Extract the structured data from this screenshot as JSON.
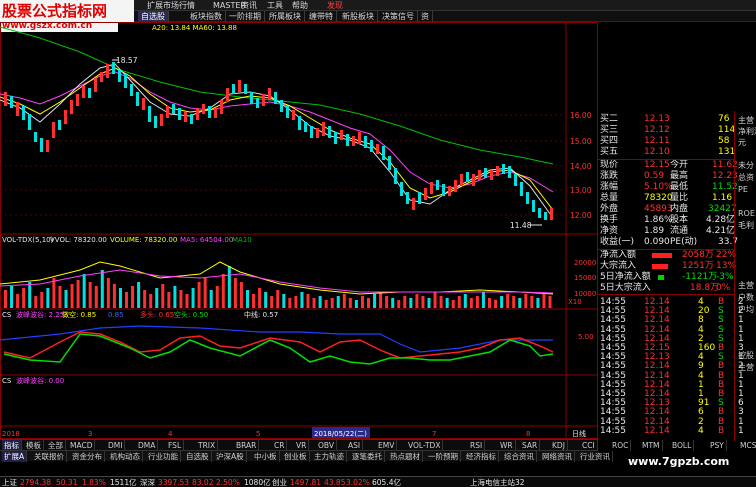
{
  "watermark": {
    "title": "股票公式指标网",
    "url": "www.gszx.com.cn",
    "bottom": "www.7gpzb.com"
  },
  "menu": {
    "items": [
      "扩展市场行情",
      "MASTER",
      "资讯",
      "工具",
      "帮助",
      "发现"
    ]
  },
  "tabs": [
    "自选股",
    "板块指数",
    "一阶排期",
    "所属板块",
    "缠带特",
    "新股板块",
    "决策信号",
    "资"
  ],
  "main_chart": {
    "ma_legend": "A20: 13.84  MA60: 13.88",
    "high_label": "18.57",
    "low_label": "11.48",
    "y_ticks": [
      "16.00",
      "15.00",
      "14.00",
      "13.00",
      "12.00"
    ]
  },
  "volume": {
    "legend_name": "VOL-TDX(5,10)",
    "legend_vvol": "VVOL: 78320.00",
    "legend_volume": "VOLUME: 78320.00",
    "legend_ma5": "MA5: 64504.00",
    "legend_ma10": "MA10",
    "y_ticks": [
      "20000",
      "15000",
      "10000"
    ],
    "unit": "X10"
  },
  "indicator1": {
    "name": "CS",
    "v1": "波峰波谷: 2.25",
    "v2": "做空: 0.85",
    "v3": "0.85",
    "v4": "多头: 0.65",
    "v5": "空头: 0.50",
    "mid": "中线: 0.57",
    "y_tick": "5.00"
  },
  "indicator2": {
    "name": "CS",
    "v1": "波峰波谷: 0.00"
  },
  "time_axis": {
    "year": "2018",
    "date_marker": "2018/05/22(二)",
    "marks": [
      "3",
      "4",
      "5",
      "6",
      "7",
      "8"
    ],
    "right": "日线"
  },
  "quote": {
    "asks": [
      {
        "label": "买二",
        "price": "12.13",
        "vol": "76"
      },
      {
        "label": "买三",
        "price": "12.12",
        "vol": "114"
      },
      {
        "label": "买四",
        "price": "12.11",
        "vol": "58"
      },
      {
        "label": "买五",
        "price": "12.10",
        "vol": "131"
      }
    ],
    "stats": [
      {
        "l1": "现价",
        "v1": "12.15",
        "l2": "今开",
        "v2": "11.62"
      },
      {
        "l1": "涨跌",
        "v1": "0.59",
        "l2": "最高",
        "v2": "12.23"
      },
      {
        "l1": "涨幅",
        "v1": "5.10%",
        "l2": "最低",
        "v2": "11.52"
      },
      {
        "l1": "总量",
        "v1": "78320",
        "l2": "量比",
        "v2": "1.16"
      },
      {
        "l1": "外盘",
        "v1": "45893",
        "l2": "内盘",
        "v2": "32427"
      },
      {
        "l1": "换手",
        "v1": "1.86%",
        "l2": "股本",
        "v2": "4.28亿"
      },
      {
        "l1": "净资",
        "v1": "1.89",
        "l2": "流通",
        "v2": "4.21亿"
      },
      {
        "l1": "收益(一)",
        "v1": "0.090",
        "l2": "PE(动)",
        "v2": "33.7"
      }
    ],
    "flows": [
      {
        "label": "净流入额",
        "value": "2058万",
        "pct": "22%",
        "bar": 0.6
      },
      {
        "label": "大宗流入",
        "value": "1251万",
        "pct": "13%",
        "bar": 0.45
      },
      {
        "label": "5日净流入额",
        "value": "-1121万",
        "pct": "-3%",
        "bar": 0.15
      },
      {
        "label": "5日大宗流入",
        "value": "18.8万",
        "pct": "0%",
        "bar": 0.05
      }
    ],
    "ticks": [
      {
        "t": "14:55",
        "p": "12.14",
        "v": "4",
        "d": "B",
        "n": "2"
      },
      {
        "t": "14:55",
        "p": "12.14",
        "v": "20",
        "d": "S",
        "n": "2"
      },
      {
        "t": "14:55",
        "p": "12.14",
        "v": "8",
        "d": "S",
        "n": "1"
      },
      {
        "t": "14:55",
        "p": "12.14",
        "v": "4",
        "d": "S",
        "n": "1"
      },
      {
        "t": "14:55",
        "p": "12.14",
        "v": "2",
        "d": "S",
        "n": "1"
      },
      {
        "t": "14:55",
        "p": "12.15",
        "v": "160",
        "d": "B",
        "n": "3"
      },
      {
        "t": "14:55",
        "p": "12.13",
        "v": "4",
        "d": "S",
        "n": "1"
      },
      {
        "t": "14:55",
        "p": "12.14",
        "v": "9",
        "d": "B",
        "n": "2"
      },
      {
        "t": "14:55",
        "p": "12.14",
        "v": "4",
        "d": "B",
        "n": "1"
      },
      {
        "t": "14:55",
        "p": "12.14",
        "v": "1",
        "d": "B",
        "n": "1"
      },
      {
        "t": "14:55",
        "p": "12.14",
        "v": "1",
        "d": "B",
        "n": "1"
      },
      {
        "t": "14:55",
        "p": "12.13",
        "v": "91",
        "d": "S",
        "n": "6"
      },
      {
        "t": "14:55",
        "p": "12.14",
        "v": "6",
        "d": "B",
        "n": "3"
      },
      {
        "t": "14:55",
        "p": "12.14",
        "v": "2",
        "d": "B",
        "n": "1"
      },
      {
        "t": "14:55",
        "p": "12.14",
        "v": "4",
        "d": "B",
        "n": "1"
      }
    ]
  },
  "side": [
    "主营",
    "净利润",
    "元",
    "未分",
    "总资",
    "PE",
    "ROE",
    "毛利",
    "主营",
    "户数",
    "户均",
    "控股",
    "主营"
  ],
  "bottom_tabs1": [
    "指标",
    "模板",
    "全部",
    "MACD",
    "DMI",
    "DMA",
    "FSL",
    "TRIX",
    "BRAR",
    "CR",
    "VR",
    "OBV",
    "ASI",
    "EMV",
    "VOL-TDX",
    "RSI",
    "WR",
    "SAR",
    "KDJ",
    "CCI",
    "ROC",
    "MTM",
    "BOLL",
    "PSY",
    "MCST",
    "CS"
  ],
  "bottom_tabs2": [
    "扩展A",
    "关联报价",
    "资金分布",
    "机构动态",
    "行业功能",
    "自选股",
    "沪深A股",
    "中小板",
    "创业板",
    "主力轨迹",
    "逐笔委托",
    "热点题材",
    "一阶预期",
    "经济指标",
    "综合资讯",
    "网络资讯",
    "行业资讯"
  ],
  "status": {
    "sh_label": "上证",
    "sh_val": "2794.38",
    "sh_chg": "50.31",
    "sh_pct": "1.83%",
    "sh_amt": "1511亿",
    "sz_label": "深深",
    "sz_val": "3397.53",
    "sz_chg": "83.02",
    "sz_pct": "2.50%",
    "sz_amt": "1080亿",
    "cy_label": "创业",
    "cy_val": "1497.81",
    "cy_chg": "43.85",
    "cy_pct": "3.02%",
    "cy_amt": "605.4亿",
    "server": "上海电信主站32"
  },
  "colors": {
    "up": "#ff3030",
    "down": "#00e0e0",
    "grid": "#8a0000"
  }
}
